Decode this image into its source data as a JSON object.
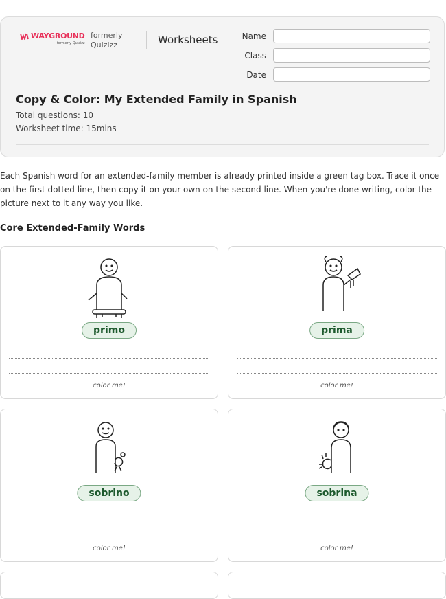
{
  "header": {
    "brand": "WAYGROUND",
    "brand_sub": "formerly Quizizz",
    "formerly": "formerly Quizizz",
    "worksheets": "Worksheets",
    "fields": {
      "name": "Name",
      "class": "Class",
      "date": "Date"
    },
    "title": "Copy & Color: My Extended Family in Spanish",
    "total_questions": "Total questions: 10",
    "worksheet_time": "Worksheet time: 15mins"
  },
  "intro": "Each Spanish word for an extended-family member is already printed inside a green tag box. Trace it once on the first dotted line, then copy it on your own on the second line. When you're done writing, color the picture next to it any way you like.",
  "section_title": "Core Extended-Family Words",
  "cards": [
    {
      "word": "primo",
      "color_me": "color me!",
      "icon": "boy-on-chair-icon"
    },
    {
      "word": "prima",
      "color_me": "color me!",
      "icon": "girl-with-sign-icon"
    },
    {
      "word": "sobrino",
      "color_me": "color me!",
      "icon": "boy-with-pet-icon"
    },
    {
      "word": "sobrina",
      "color_me": "color me!",
      "icon": "girl-with-cat-icon"
    }
  ]
}
